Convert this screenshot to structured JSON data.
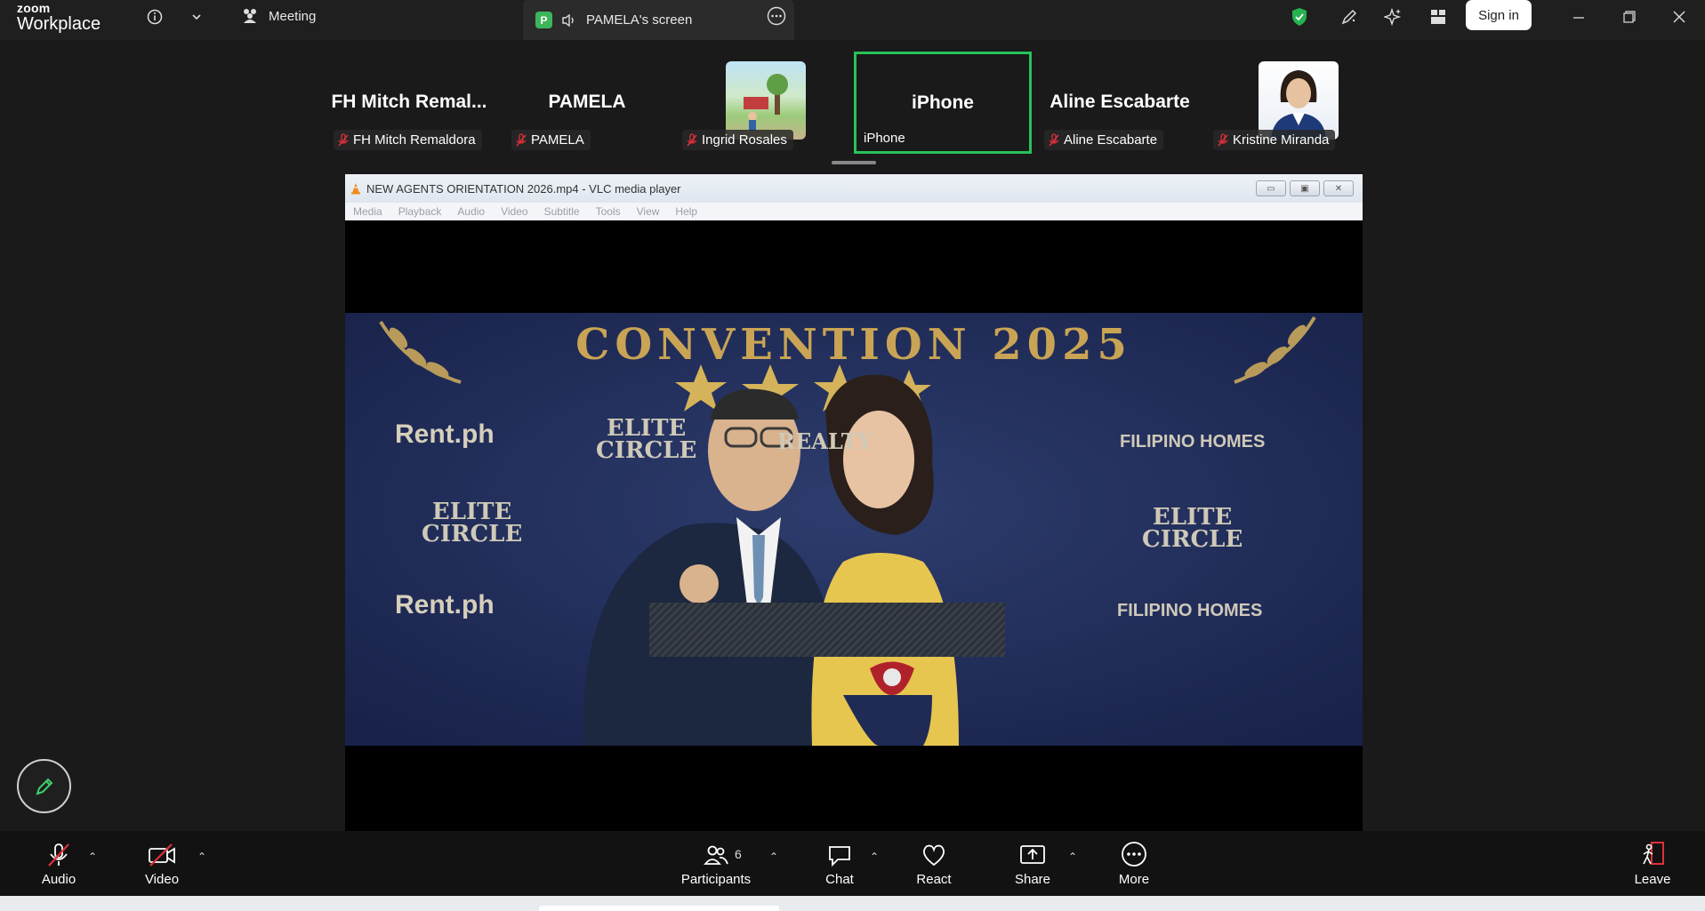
{
  "app": {
    "logo_line1": "zoom",
    "logo_line2": "Workplace"
  },
  "topbar": {
    "meeting_tab": "Meeting",
    "screen_tab": "PAMELA's screen",
    "screen_badge": "P",
    "signin_label": "Sign in",
    "accent_green": "#27c25a"
  },
  "gallery": [
    {
      "big": "FH  Mitch  Remal...",
      "name": "FH Mitch Remaldora",
      "muted": true,
      "type": "text"
    },
    {
      "big": "PAMELA",
      "name": "PAMELA",
      "muted": true,
      "type": "text"
    },
    {
      "big": "",
      "name": "Ingrid Rosales",
      "muted": true,
      "type": "image"
    },
    {
      "big": "iPhone",
      "name": "iPhone",
      "muted": false,
      "type": "text",
      "active": true
    },
    {
      "big": "Aline Escabarte",
      "name": "Aline Escabarte",
      "muted": true,
      "type": "text"
    },
    {
      "big": "",
      "name": "Kristine Miranda",
      "muted": true,
      "type": "photo"
    }
  ],
  "vlc": {
    "title": "NEW AGENTS ORIENTATION 2026.mp4 - VLC media player",
    "menu": [
      "Media",
      "Playback",
      "Audio",
      "Video",
      "Subtitle",
      "Tools",
      "View",
      "Help"
    ]
  },
  "video": {
    "banner": "CONVENTION 2025",
    "brand_rent": "Rent.ph",
    "brand_elite_1": "ELITE",
    "brand_elite_2": "CIRCLE",
    "brand_fh": "FILIPINO HOMES",
    "brand_realty": "REALTY"
  },
  "toolbar": {
    "audio": "Audio",
    "video": "Video",
    "participants": "Participants",
    "participants_count": "6",
    "chat": "Chat",
    "react": "React",
    "share": "Share",
    "more": "More",
    "leave": "Leave"
  }
}
